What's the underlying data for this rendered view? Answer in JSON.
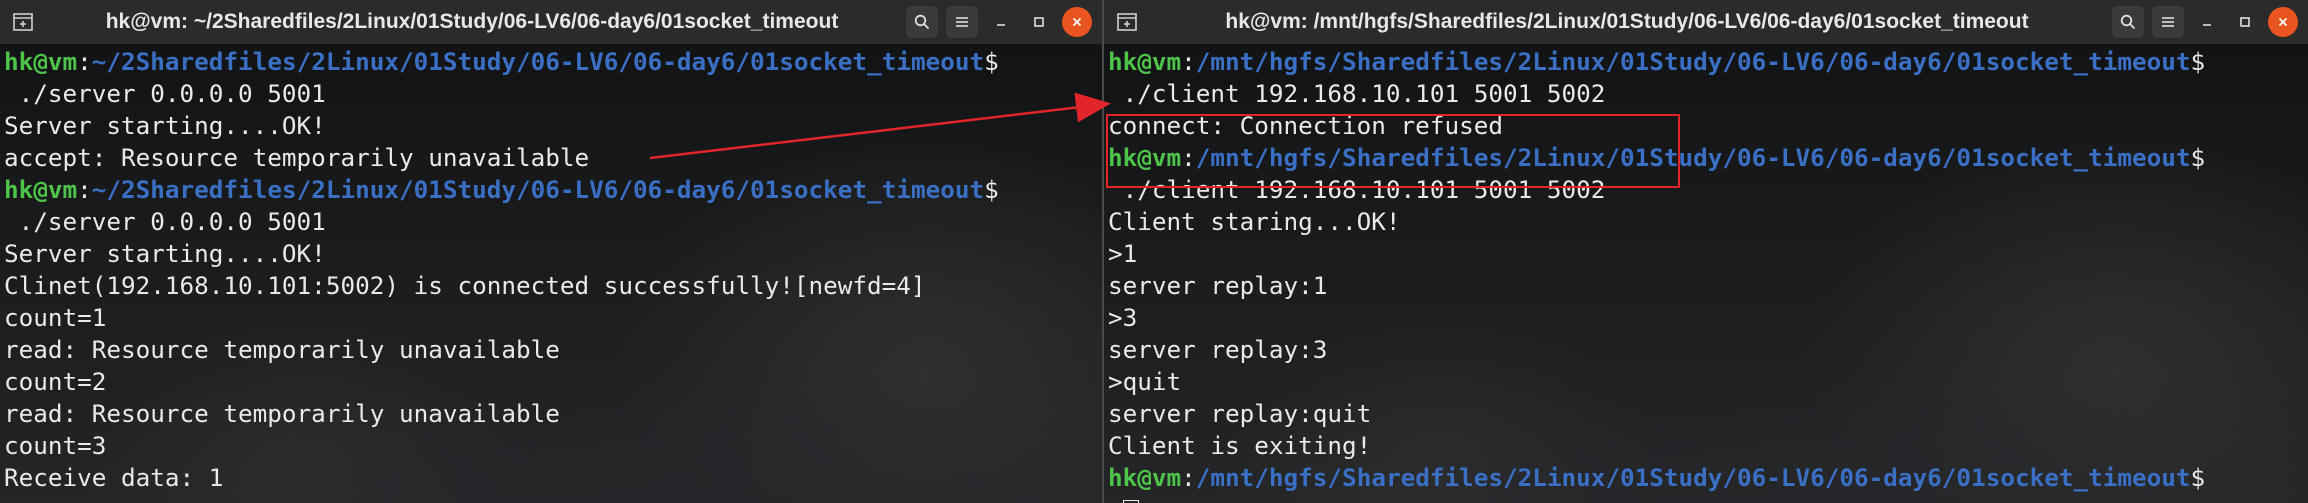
{
  "left_terminal": {
    "title": "hk@vm: ~/2Sharedfiles/2Linux/01Study/06-LV6/06-day6/01socket_timeout",
    "lines": [
      {
        "type": "prompt",
        "user": "hk@vm",
        "sep": ":",
        "path": "~/2Sharedfiles/2Linux/01Study/06-LV6/06-day6/01socket_timeout",
        "dollar": "$"
      },
      {
        "type": "text",
        "text": " ./server 0.0.0.0 5001"
      },
      {
        "type": "text",
        "text": "Server starting....OK!"
      },
      {
        "type": "text",
        "text": "accept: Resource temporarily unavailable"
      },
      {
        "type": "prompt",
        "user": "hk@vm",
        "sep": ":",
        "path": "~/2Sharedfiles/2Linux/01Study/06-LV6/06-day6/01socket_timeout",
        "dollar": "$"
      },
      {
        "type": "text",
        "text": " ./server 0.0.0.0 5001"
      },
      {
        "type": "text",
        "text": "Server starting....OK!"
      },
      {
        "type": "text",
        "text": "Clinet(192.168.10.101:5002) is connected successfully![newfd=4]"
      },
      {
        "type": "text",
        "text": "count=1"
      },
      {
        "type": "text",
        "text": "read: Resource temporarily unavailable"
      },
      {
        "type": "text",
        "text": "count=2"
      },
      {
        "type": "text",
        "text": "read: Resource temporarily unavailable"
      },
      {
        "type": "text",
        "text": "count=3"
      },
      {
        "type": "text",
        "text": "Receive data: 1"
      }
    ]
  },
  "right_terminal": {
    "title": "hk@vm: /mnt/hgfs/Sharedfiles/2Linux/01Study/06-LV6/06-day6/01socket_timeout",
    "lines": [
      {
        "type": "prompt",
        "user": "hk@vm",
        "sep": ":",
        "path": "/mnt/hgfs/Sharedfiles/2Linux/01Study/06-LV6/06-day6/01socket_timeout",
        "dollar": "$"
      },
      {
        "type": "text",
        "text": " ./client 192.168.10.101 5001 5002"
      },
      {
        "type": "text",
        "text": "connect: Connection refused"
      },
      {
        "type": "prompt",
        "user": "hk@vm",
        "sep": ":",
        "path": "/mnt/hgfs/Sharedfiles/2Linux/01Study/06-LV6/06-day6/01socket_timeout",
        "dollar": "$"
      },
      {
        "type": "text",
        "text": " ./client 192.168.10.101 5001 5002"
      },
      {
        "type": "text",
        "text": "Client staring...OK!"
      },
      {
        "type": "text",
        "text": ">1"
      },
      {
        "type": "text",
        "text": "server replay:1"
      },
      {
        "type": "text",
        "text": ">3"
      },
      {
        "type": "text",
        "text": "server replay:3"
      },
      {
        "type": "text",
        "text": ">quit"
      },
      {
        "type": "text",
        "text": "server replay:quit"
      },
      {
        "type": "text",
        "text": "Client is exiting!"
      },
      {
        "type": "prompt",
        "user": "hk@vm",
        "sep": ":",
        "path": "/mnt/hgfs/Sharedfiles/2Linux/01Study/06-LV6/06-day6/01socket_timeout",
        "dollar": "$"
      },
      {
        "type": "cursor"
      }
    ]
  },
  "icons": {
    "new_tab": "new-tab-icon",
    "search": "search-icon",
    "menu": "hamburger-menu-icon",
    "minimize": "minimize-icon",
    "maximize": "maximize-icon",
    "close": "close-icon"
  },
  "colors": {
    "prompt_user": "#4ec34a",
    "prompt_path": "#3b6fc4",
    "text": "#e9e9e9",
    "annotation": "#e2252b",
    "close_button": "#e95420"
  }
}
